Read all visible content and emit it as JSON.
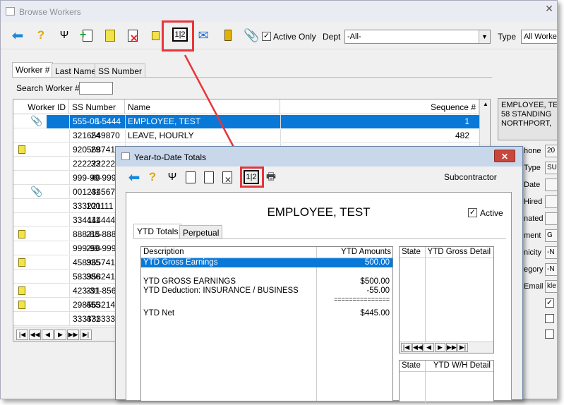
{
  "main_window": {
    "title": "Browse Workers",
    "toolbar": {
      "icons": [
        "back-arrow-icon",
        "help-icon",
        "worker-tools-icon",
        "add-icon",
        "edit-icon",
        "delete-icon",
        "note-icon",
        "ytd-totals-icon",
        "email-icon",
        "book-icon",
        "attachment-icon"
      ],
      "active_only_label": "Active Only",
      "active_only_checked": true,
      "dept_label": "Dept",
      "dept_value": "-All-",
      "type_label": "Type",
      "type_value": "All Worke"
    },
    "tabs": [
      "Worker #",
      "Last Name",
      "SS Number"
    ],
    "search_label": "Search Worker #",
    "search_value": "",
    "columns": [
      "Worker ID",
      "SS Number",
      "Name",
      "Sequence #"
    ],
    "rows": [
      {
        "icon": "attachment",
        "id": "1",
        "ss": "555-08-5444",
        "name": "EMPLOYEE, TEST",
        "seq": "1",
        "selected": true
      },
      {
        "icon": "",
        "id": "24",
        "ss": "3216549870",
        "name": "LEAVE, HOURLY",
        "seq": "482",
        "selected": false
      },
      {
        "icon": "note",
        "id": "29",
        "ss": "920568741",
        "name": "",
        "seq": "",
        "selected": false
      },
      {
        "icon": "",
        "id": "33",
        "ss": "222222222",
        "name": "",
        "seq": "",
        "selected": false
      },
      {
        "icon": "",
        "id": "40",
        "ss": "999-99-9991",
        "name": "",
        "seq": "",
        "selected": false
      },
      {
        "icon": "attachment",
        "id": "41",
        "ss": "001234567",
        "name": "",
        "seq": "",
        "selected": false
      },
      {
        "icon": "",
        "id": "100",
        "ss": "333221111",
        "name": "",
        "seq": "",
        "selected": false
      },
      {
        "icon": "",
        "id": "111",
        "ss": "3344444444",
        "name": "",
        "seq": "",
        "selected": false
      },
      {
        "icon": "note",
        "id": "215",
        "ss": "888-88-8888",
        "name": "",
        "seq": "",
        "selected": false
      },
      {
        "icon": "",
        "id": "250",
        "ss": "999-99-9999",
        "name": "",
        "seq": "",
        "selected": false
      },
      {
        "icon": "note",
        "id": "335",
        "ss": "458965741",
        "name": "",
        "seq": "",
        "selected": false
      },
      {
        "icon": "",
        "id": "386",
        "ss": "5839582416",
        "name": "",
        "seq": "",
        "selected": false
      },
      {
        "icon": "note",
        "id": "391",
        "ss": "423-31-8567",
        "name": "",
        "seq": "",
        "selected": false
      },
      {
        "icon": "note",
        "id": "455",
        "ss": "298563214",
        "name": "",
        "seq": "",
        "selected": false
      },
      {
        "icon": "",
        "id": "471",
        "ss": "333333333",
        "name": "",
        "seq": "",
        "selected": false
      }
    ],
    "nav_buttons": [
      "|◀",
      "◀◀",
      "◀",
      "▶",
      "▶▶",
      "▶|"
    ],
    "address": [
      "EMPLOYEE, TES",
      "58 STANDING",
      "NORTHPORT,"
    ],
    "right_labels": [
      "hone",
      "Type",
      "Date",
      "Hired",
      "nated",
      "ment",
      "nicity",
      "egory",
      "Email"
    ],
    "right_values": [
      "20",
      "SU",
      "",
      "",
      "",
      "G",
      "-N",
      "-N",
      "kle"
    ]
  },
  "popup": {
    "title": "Year-to-Date Totals",
    "subcontractor_label": "Subcontractor",
    "employee_name": "EMPLOYEE, TEST",
    "active_label": "Active",
    "active_checked": true,
    "tabs": [
      "YTD Totals",
      "Perpetual"
    ],
    "ytd_table": {
      "col_description": "Description",
      "col_amounts": "YTD Amounts",
      "selected_row": {
        "desc": "YTD Gross Earnings",
        "amount": "500.00"
      },
      "lines": [
        {
          "desc": "YTD GROSS EARNINGS",
          "amount": "$500.00"
        },
        {
          "desc": "YTD Deduction: INSURANCE / BUSINESS",
          "amount": "-55.00"
        },
        {
          "desc": "",
          "amount": "==============="
        },
        {
          "desc": "YTD Net",
          "amount": "$445.00"
        }
      ]
    },
    "gross_detail": {
      "col_state": "State",
      "col_detail": "YTD Gross Detail"
    },
    "wh_detail": {
      "col_state": "State",
      "col_detail": "YTD W/H Detail"
    }
  },
  "colors": {
    "selection": "#0a78d7",
    "highlight": "#e8353a",
    "popup_title_bar": "#c8d7ea",
    "close_button": "#c9463d"
  }
}
